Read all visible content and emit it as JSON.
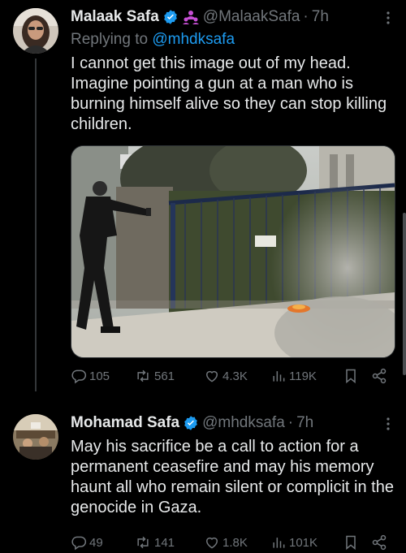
{
  "tweets": [
    {
      "name": "Malaak Safa",
      "handle": "@MalaakSafa",
      "time": "7h",
      "replying_label": "Replying to",
      "replying_to": "@mhdksafa",
      "text": "I cannot get this image out of my head. Imagine pointing a gun at a man who is burning himself alive so they can stop killing children.",
      "stats": {
        "replies": "105",
        "retweets": "561",
        "likes": "4.3K",
        "views": "119K"
      }
    },
    {
      "name": "Mohamad Safa",
      "handle": "@mhdksafa",
      "time": "7h",
      "text": "May his sacrifice be a call to action for a permanent ceasefire and may his memory haunt all who remain silent or complicit in the genocide in Gaza.",
      "stats": {
        "replies": "49",
        "retweets": "141",
        "likes": "1.8K",
        "views": "101K"
      }
    }
  ],
  "separator": "·",
  "colors": {
    "background": "#000000",
    "text": "#e7e9ea",
    "secondary": "#71767b",
    "accent": "#1d9bf0",
    "affiliate_badge": "#c64fd4"
  },
  "icons": {
    "verified": "verified-badge-icon",
    "affiliate": "people-affiliate-icon",
    "reply": "reply-icon",
    "retweet": "retweet-icon",
    "like": "heart-icon",
    "views": "views-chart-icon",
    "bookmark": "bookmark-icon",
    "share": "share-icon",
    "more": "more-icon"
  }
}
